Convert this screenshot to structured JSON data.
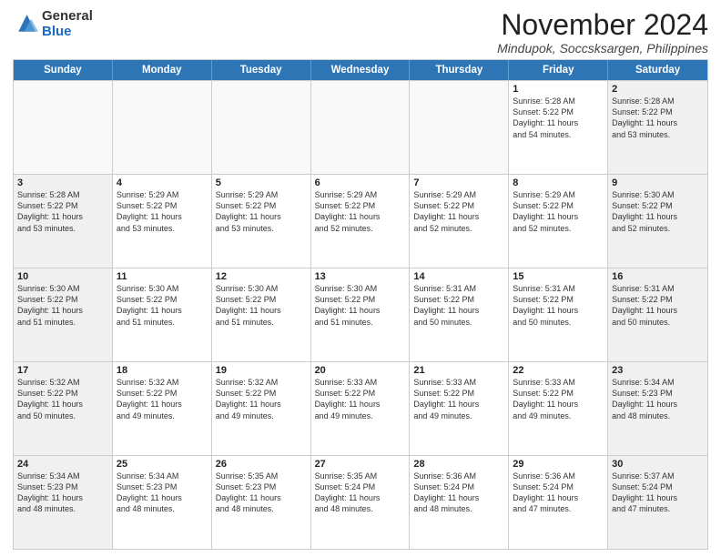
{
  "logo": {
    "general": "General",
    "blue": "Blue"
  },
  "title": "November 2024",
  "location": "Mindupok, Soccsksargen, Philippines",
  "header": {
    "days": [
      "Sunday",
      "Monday",
      "Tuesday",
      "Wednesday",
      "Thursday",
      "Friday",
      "Saturday"
    ]
  },
  "rows": [
    [
      {
        "day": "",
        "info": ""
      },
      {
        "day": "",
        "info": ""
      },
      {
        "day": "",
        "info": ""
      },
      {
        "day": "",
        "info": ""
      },
      {
        "day": "",
        "info": ""
      },
      {
        "day": "1",
        "info": "Sunrise: 5:28 AM\nSunset: 5:22 PM\nDaylight: 11 hours\nand 54 minutes."
      },
      {
        "day": "2",
        "info": "Sunrise: 5:28 AM\nSunset: 5:22 PM\nDaylight: 11 hours\nand 53 minutes."
      }
    ],
    [
      {
        "day": "3",
        "info": "Sunrise: 5:28 AM\nSunset: 5:22 PM\nDaylight: 11 hours\nand 53 minutes."
      },
      {
        "day": "4",
        "info": "Sunrise: 5:29 AM\nSunset: 5:22 PM\nDaylight: 11 hours\nand 53 minutes."
      },
      {
        "day": "5",
        "info": "Sunrise: 5:29 AM\nSunset: 5:22 PM\nDaylight: 11 hours\nand 53 minutes."
      },
      {
        "day": "6",
        "info": "Sunrise: 5:29 AM\nSunset: 5:22 PM\nDaylight: 11 hours\nand 52 minutes."
      },
      {
        "day": "7",
        "info": "Sunrise: 5:29 AM\nSunset: 5:22 PM\nDaylight: 11 hours\nand 52 minutes."
      },
      {
        "day": "8",
        "info": "Sunrise: 5:29 AM\nSunset: 5:22 PM\nDaylight: 11 hours\nand 52 minutes."
      },
      {
        "day": "9",
        "info": "Sunrise: 5:30 AM\nSunset: 5:22 PM\nDaylight: 11 hours\nand 52 minutes."
      }
    ],
    [
      {
        "day": "10",
        "info": "Sunrise: 5:30 AM\nSunset: 5:22 PM\nDaylight: 11 hours\nand 51 minutes."
      },
      {
        "day": "11",
        "info": "Sunrise: 5:30 AM\nSunset: 5:22 PM\nDaylight: 11 hours\nand 51 minutes."
      },
      {
        "day": "12",
        "info": "Sunrise: 5:30 AM\nSunset: 5:22 PM\nDaylight: 11 hours\nand 51 minutes."
      },
      {
        "day": "13",
        "info": "Sunrise: 5:30 AM\nSunset: 5:22 PM\nDaylight: 11 hours\nand 51 minutes."
      },
      {
        "day": "14",
        "info": "Sunrise: 5:31 AM\nSunset: 5:22 PM\nDaylight: 11 hours\nand 50 minutes."
      },
      {
        "day": "15",
        "info": "Sunrise: 5:31 AM\nSunset: 5:22 PM\nDaylight: 11 hours\nand 50 minutes."
      },
      {
        "day": "16",
        "info": "Sunrise: 5:31 AM\nSunset: 5:22 PM\nDaylight: 11 hours\nand 50 minutes."
      }
    ],
    [
      {
        "day": "17",
        "info": "Sunrise: 5:32 AM\nSunset: 5:22 PM\nDaylight: 11 hours\nand 50 minutes."
      },
      {
        "day": "18",
        "info": "Sunrise: 5:32 AM\nSunset: 5:22 PM\nDaylight: 11 hours\nand 49 minutes."
      },
      {
        "day": "19",
        "info": "Sunrise: 5:32 AM\nSunset: 5:22 PM\nDaylight: 11 hours\nand 49 minutes."
      },
      {
        "day": "20",
        "info": "Sunrise: 5:33 AM\nSunset: 5:22 PM\nDaylight: 11 hours\nand 49 minutes."
      },
      {
        "day": "21",
        "info": "Sunrise: 5:33 AM\nSunset: 5:22 PM\nDaylight: 11 hours\nand 49 minutes."
      },
      {
        "day": "22",
        "info": "Sunrise: 5:33 AM\nSunset: 5:22 PM\nDaylight: 11 hours\nand 49 minutes."
      },
      {
        "day": "23",
        "info": "Sunrise: 5:34 AM\nSunset: 5:23 PM\nDaylight: 11 hours\nand 48 minutes."
      }
    ],
    [
      {
        "day": "24",
        "info": "Sunrise: 5:34 AM\nSunset: 5:23 PM\nDaylight: 11 hours\nand 48 minutes."
      },
      {
        "day": "25",
        "info": "Sunrise: 5:34 AM\nSunset: 5:23 PM\nDaylight: 11 hours\nand 48 minutes."
      },
      {
        "day": "26",
        "info": "Sunrise: 5:35 AM\nSunset: 5:23 PM\nDaylight: 11 hours\nand 48 minutes."
      },
      {
        "day": "27",
        "info": "Sunrise: 5:35 AM\nSunset: 5:24 PM\nDaylight: 11 hours\nand 48 minutes."
      },
      {
        "day": "28",
        "info": "Sunrise: 5:36 AM\nSunset: 5:24 PM\nDaylight: 11 hours\nand 48 minutes."
      },
      {
        "day": "29",
        "info": "Sunrise: 5:36 AM\nSunset: 5:24 PM\nDaylight: 11 hours\nand 47 minutes."
      },
      {
        "day": "30",
        "info": "Sunrise: 5:37 AM\nSunset: 5:24 PM\nDaylight: 11 hours\nand 47 minutes."
      }
    ]
  ]
}
